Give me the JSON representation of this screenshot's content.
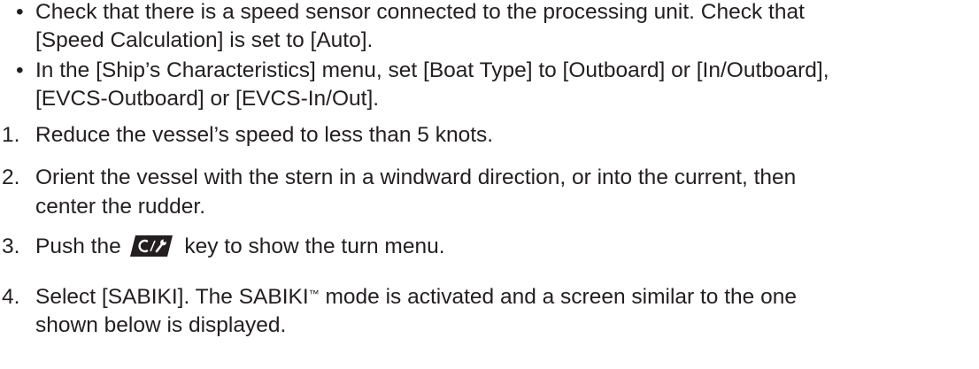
{
  "bullets": [
    {
      "mark": "•",
      "line1": "Check that there is a speed sensor connected to the processing unit. Check that",
      "line2": "[Speed Calculation] is set to [Auto]."
    },
    {
      "mark": "•",
      "line1": "In the [Ship’s Characteristics] menu, set [Boat Type] to [Outboard] or [In/Outboard],",
      "line2": "[EVCS-Outboard] or [EVCS-In/Out]."
    }
  ],
  "steps": [
    {
      "num": "1.",
      "line1": "Reduce the vessel’s speed to less than 5 knots."
    },
    {
      "num": "2.",
      "line1": "Orient the vessel with the stern in a windward direction, or into the current, then",
      "line2": "center the rudder."
    },
    {
      "num": "3.",
      "before": "Push the",
      "key_icon": "cancel-wrench-key-icon",
      "after": "key to show the turn menu."
    },
    {
      "num": "4.",
      "line1_a": "Select [SABIKI]. The SABIKI",
      "tm": "™",
      "line1_b": " mode is activated and a screen similar to the one",
      "line2": "shown below is displayed."
    }
  ],
  "colors": {
    "text": "#231f20",
    "key_fill": "#231f20",
    "key_glyph": "#ffffff"
  }
}
